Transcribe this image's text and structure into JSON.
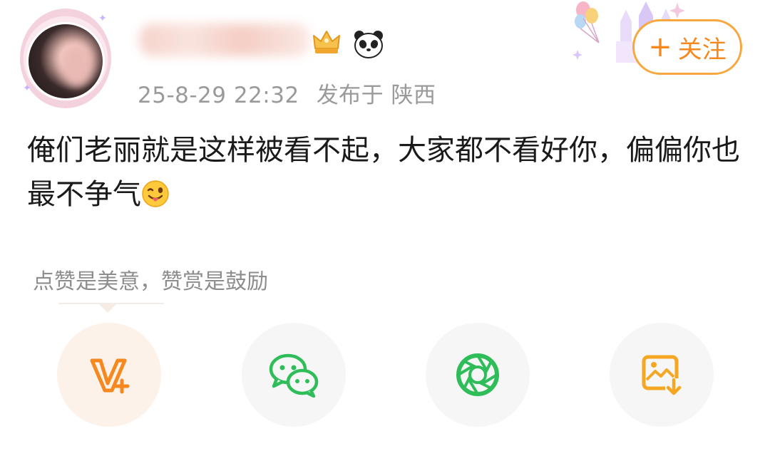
{
  "post": {
    "timestamp": "25-8-29 22:32",
    "location": "发布于 陕西",
    "content": "俺们老丽就是这样被看不起，大家都不看好你，偏偏你也最不争气"
  },
  "follow_button": {
    "plus": "+",
    "label": "关注"
  },
  "reward_hint": "点赞是美意，赞赏是鼓励",
  "share_options": [
    {
      "icon": "vip-plus-icon",
      "color": "#f5881f"
    },
    {
      "icon": "wechat-icon",
      "color": "#2fbd5a"
    },
    {
      "icon": "moments-icon",
      "color": "#2fbd5a"
    },
    {
      "icon": "save-image-icon",
      "color": "#f5a623"
    }
  ],
  "colors": {
    "accent": "#f5881f",
    "follow_border": "#f7a73d",
    "muted": "#9a9a9a"
  }
}
